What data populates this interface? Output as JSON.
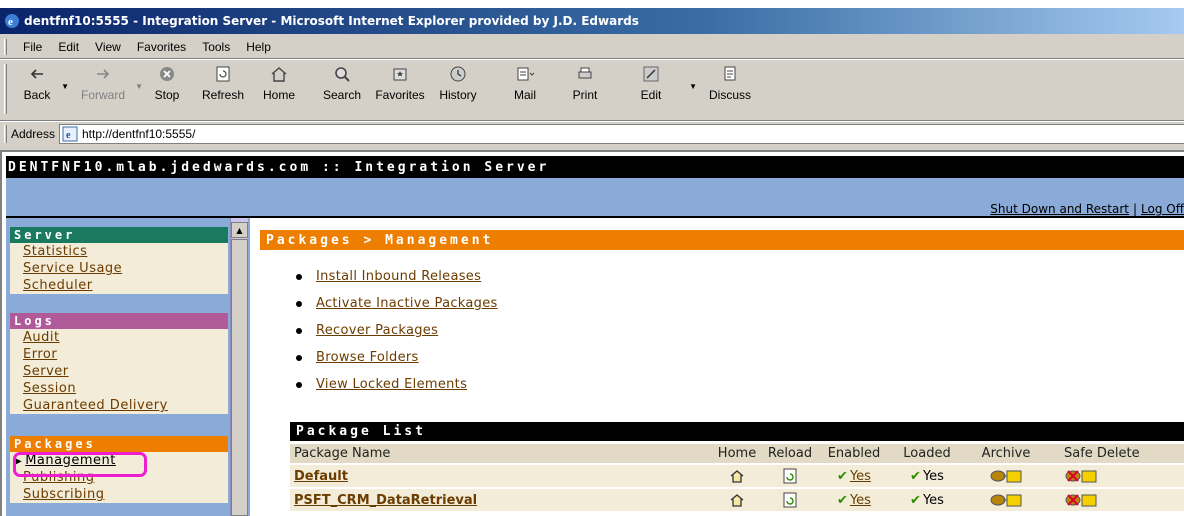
{
  "window": {
    "title": "dentfnf10:5555 - Integration Server - Microsoft Internet Explorer provided by J.D. Edwards"
  },
  "menu": [
    "File",
    "Edit",
    "View",
    "Favorites",
    "Tools",
    "Help"
  ],
  "toolbar": {
    "back": "Back",
    "forward": "Forward",
    "stop": "Stop",
    "refresh": "Refresh",
    "home": "Home",
    "search": "Search",
    "favorites": "Favorites",
    "history": "History",
    "mail": "Mail",
    "print": "Print",
    "edit": "Edit",
    "discuss": "Discuss"
  },
  "address": {
    "label": "Address",
    "url": "http://dentfnf10:5555/"
  },
  "header": {
    "title": "DENTFNF10.mlab.jdedwards.com :: Integration Server",
    "shutdown": "Shut Down and Restart",
    "logoff": "Log Off"
  },
  "sidebar": {
    "server": {
      "heading": "Server",
      "links": [
        "Statistics",
        "Service Usage",
        "Scheduler"
      ]
    },
    "logs": {
      "heading": "Logs",
      "links": [
        "Audit",
        "Error",
        "Server",
        "Session",
        "Guaranteed Delivery"
      ]
    },
    "packages": {
      "heading": "Packages",
      "active": "Management",
      "links": [
        "Publishing",
        "Subscribing"
      ]
    }
  },
  "main": {
    "breadcrumb": "Packages > Management",
    "actions": [
      "Install Inbound Releases",
      "Activate Inactive Packages",
      "Recover Packages",
      "Browse Folders",
      "View Locked Elements"
    ]
  },
  "package_list": {
    "title": "Package List",
    "columns": [
      "Package Name",
      "Home",
      "Reload",
      "Enabled",
      "Loaded",
      "Archive",
      "Safe Delete"
    ],
    "rows": [
      {
        "name": "Default",
        "enabled": "Yes",
        "loaded": "Yes"
      },
      {
        "name": "PSFT_CRM_DataRetrieval",
        "enabled": "Yes",
        "loaded": "Yes"
      }
    ]
  },
  "colors": {
    "orange": "#ee7e00",
    "server_green": "#1a7a60",
    "logs_purple": "#b05a9a",
    "nav_blue": "#8aaad8",
    "link_brown": "#6b3c00",
    "highlight": "#ee1ed0"
  }
}
